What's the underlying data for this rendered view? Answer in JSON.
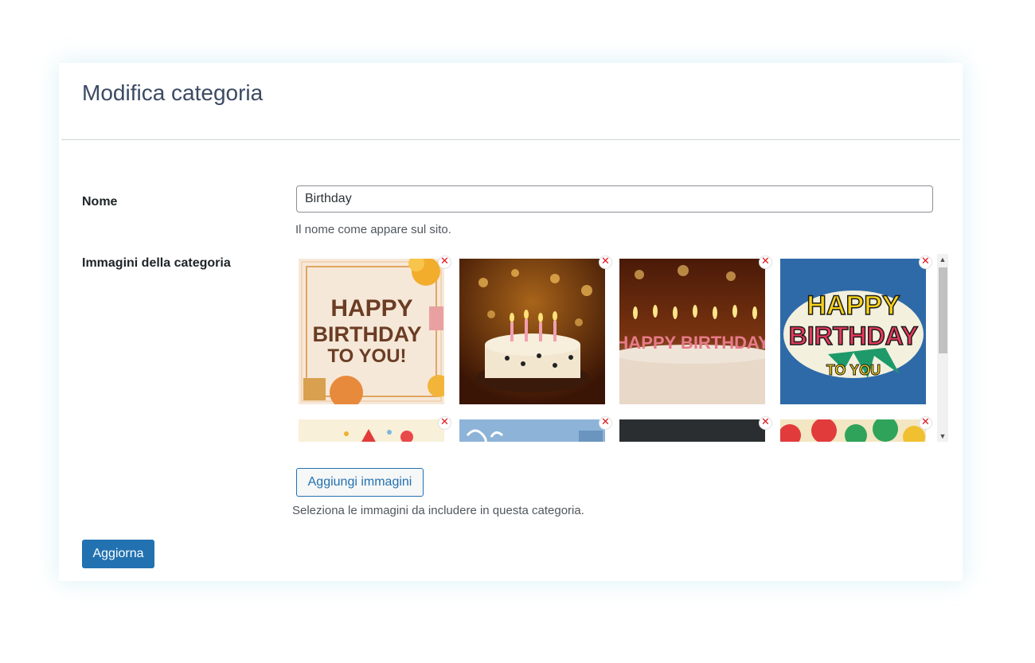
{
  "page": {
    "title": "Modifica categoria"
  },
  "form": {
    "name_label": "Nome",
    "name_value": "Birthday",
    "name_help": "Il nome come appare sul sito.",
    "images_label": "Immagini della categoria",
    "add_images_label": "Aggiungi immagini",
    "images_help": "Seleziona le immagini da includere in questa categoria.",
    "submit_label": "Aggiorna"
  },
  "images": [
    {
      "name": "happy-birthday-balloons-card",
      "text_lines": [
        "HAPPY",
        "BIRTHDAY",
        "TO YOU!"
      ]
    },
    {
      "name": "birthday-cake-candles-photo"
    },
    {
      "name": "birthday-candles-letters-cake",
      "text": "HAPPY BIRTHDAY"
    },
    {
      "name": "comic-happy-birthday-card",
      "text_lines": [
        "HAPPY",
        "BIRTHDAY",
        "TO YOU"
      ]
    },
    {
      "name": "party-pattern-thumbnail"
    },
    {
      "name": "lettering-blue-thumbnail"
    },
    {
      "name": "chalkboard-thumbnail"
    },
    {
      "name": "balloons-colorful-thumbnail"
    }
  ],
  "icons": {
    "remove": "close-icon",
    "scroll_up": "chevron-up-icon",
    "scroll_down": "chevron-down-icon"
  },
  "colors": {
    "primary": "#2271b1",
    "remove": "#e3131b",
    "title": "#3c4a63"
  }
}
